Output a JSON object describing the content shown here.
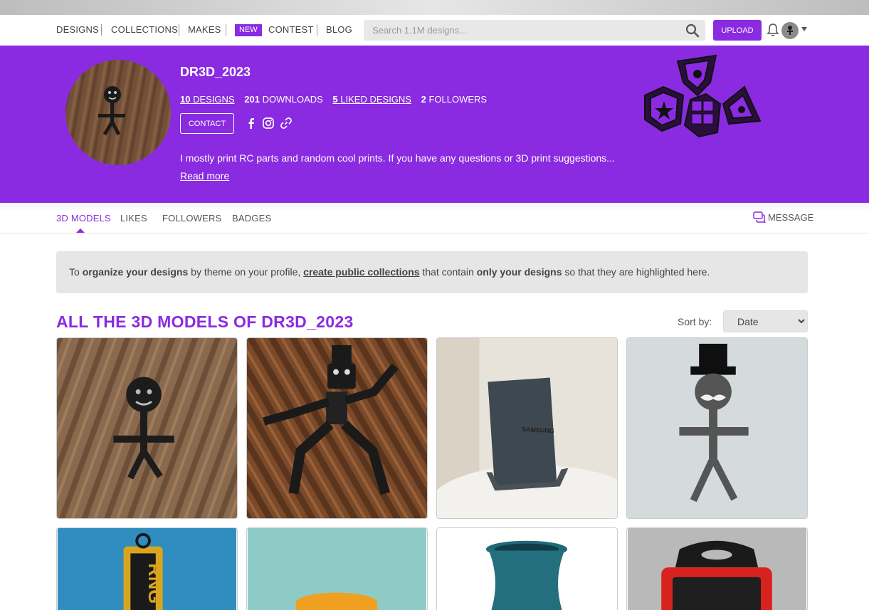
{
  "nav": {
    "items": [
      "DESIGNS",
      "COLLECTIONS",
      "MAKES",
      "CONTEST",
      "BLOG"
    ],
    "new_badge": "NEW",
    "search_placeholder": "Search 1.1M designs...",
    "upload_label": "UPLOAD"
  },
  "profile": {
    "name": "DR3D_2023",
    "stats": {
      "designs_count": "10",
      "designs_label": "DESIGNS",
      "downloads_count": "201",
      "downloads_label": "DOWNLOADS",
      "liked_count": "5",
      "liked_label": "LIKED DESIGNS",
      "followers_count": "2",
      "followers_label": "FOLLOWERS"
    },
    "contact_label": "CONTACT",
    "social_icons": [
      "facebook-icon",
      "instagram-icon",
      "link-icon"
    ],
    "bio": "I mostly print RC parts and random cool prints. If you have any questions or 3D print suggestions...",
    "read_more": "Read more"
  },
  "tabs": {
    "items": [
      "3D MODELS",
      "LIKES",
      "FOLLOWERS",
      "BADGES"
    ],
    "active": "3D MODELS",
    "message_label": "MESSAGE"
  },
  "info": {
    "p1": "To ",
    "b1": "organize your designs",
    "p2": " by theme on your profile, ",
    "link": "create public collections",
    "p3": " that contain ",
    "b2": "only your designs",
    "p4": " so that they are highlighted here."
  },
  "section": {
    "title": "ALL THE 3D MODELS OF DR3D_2023",
    "sort_label": "Sort by:",
    "sort_value": "Date"
  },
  "colors": {
    "accent": "#8a2be2",
    "info_bg": "#e6e6e6"
  }
}
